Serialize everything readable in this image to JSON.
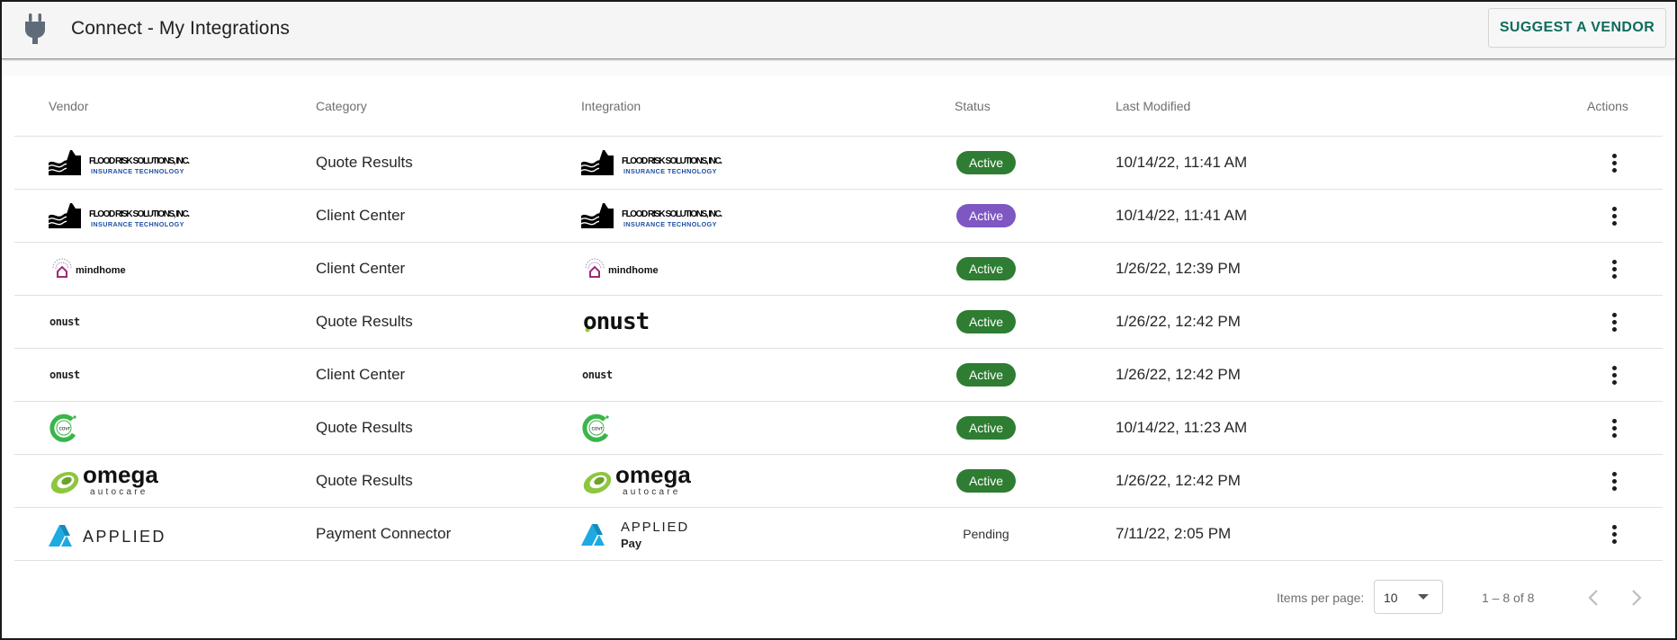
{
  "header": {
    "title": "Connect - My Integrations",
    "suggest_label": "SUGGEST A VENDOR",
    "icon": "plug-icon"
  },
  "table": {
    "columns": {
      "vendor": "Vendor",
      "category": "Category",
      "integration": "Integration",
      "status": "Status",
      "modified": "Last Modified",
      "actions": "Actions"
    },
    "rows": [
      {
        "vendor_logo": "flood-risk-logo",
        "category": "Quote Results",
        "integration_logo": "flood-risk-logo",
        "status": "Active",
        "status_color": "#2e7d32",
        "modified": "10/14/22, 11:41 AM"
      },
      {
        "vendor_logo": "flood-risk-logo",
        "category": "Client Center",
        "integration_logo": "flood-risk-logo",
        "status": "Active",
        "status_color": "#7e57c2",
        "modified": "10/14/22, 11:41 AM"
      },
      {
        "vendor_logo": "mindhome-logo",
        "category": "Client Center",
        "integration_logo": "mindhome-logo",
        "status": "Active",
        "status_color": "#2e7d32",
        "modified": "1/26/22, 12:39 PM"
      },
      {
        "vendor_logo": "onust-logo",
        "category": "Quote Results",
        "integration_logo": "onust-logo",
        "status": "Active",
        "status_color": "#2e7d32",
        "modified": "1/26/22, 12:42 PM"
      },
      {
        "vendor_logo": "onust-logo",
        "category": "Client Center",
        "integration_logo": "onust-logo",
        "status": "Active",
        "status_color": "#2e7d32",
        "modified": "1/26/22, 12:42 PM"
      },
      {
        "vendor_logo": "covr-logo",
        "category": "Quote Results",
        "integration_logo": "covr-logo",
        "status": "Active",
        "status_color": "#2e7d32",
        "modified": "10/14/22, 11:23 AM"
      },
      {
        "vendor_logo": "omega-autocare-logo",
        "category": "Quote Results",
        "integration_logo": "omega-autocare-logo",
        "status": "Active",
        "status_color": "#2e7d32",
        "modified": "1/26/22, 12:42 PM"
      },
      {
        "vendor_logo": "applied-logo",
        "category": "Payment Connector",
        "integration_logo": "applied-pay-logo",
        "status": "Pending",
        "status_color": "",
        "modified": "7/11/22, 2:05 PM"
      }
    ]
  },
  "logos": {
    "flood": {
      "line1": "FLOOD RISK SOLUTIONS, INC.",
      "line2": "INSURANCE TECHNOLOGY"
    },
    "mindhome": "mindhome",
    "onust": "onust",
    "covr": "covr",
    "omega": {
      "name": "omega",
      "sub": "autocare"
    },
    "applied": {
      "name": "APPLIED",
      "pay": "Pay"
    }
  },
  "paginator": {
    "items_per_page_label": "Items per page:",
    "items_per_page_value": "10",
    "range_label": "1 – 8 of 8"
  },
  "colors": {
    "accent": "#0f6b5c",
    "active_green": "#2e7d32",
    "active_purple": "#7e57c2",
    "applied_blue": "#1fa9e1",
    "covr_green": "#3ab54a",
    "omega_green": "#8dc63f",
    "flood_blue": "#1f4fa3"
  }
}
